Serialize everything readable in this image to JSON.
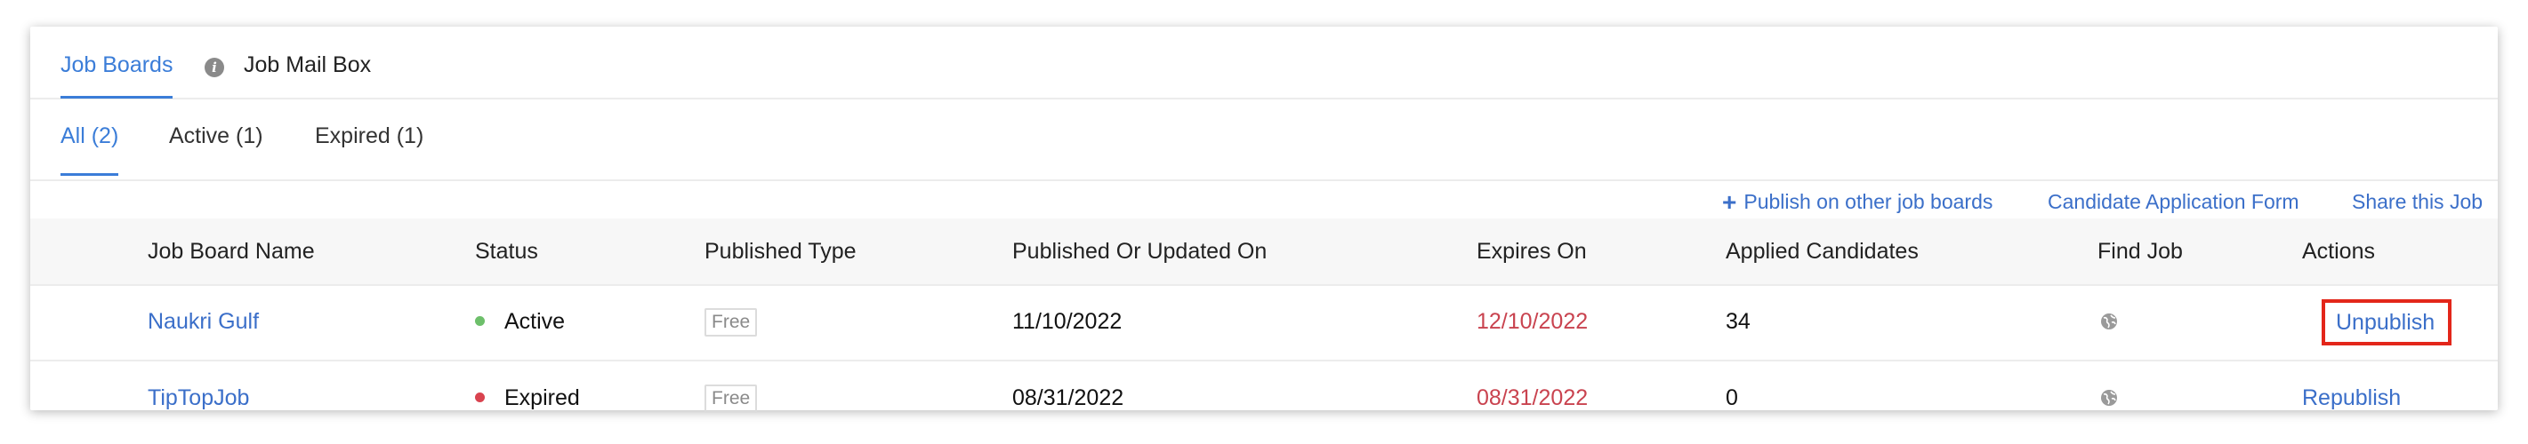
{
  "top_tabs": [
    {
      "label": "Job Boards",
      "active": true
    },
    {
      "label": "Job Mail Box",
      "active": false
    }
  ],
  "sub_tabs": [
    {
      "label": "All (2)",
      "active": true
    },
    {
      "label": "Active (1)",
      "active": false
    },
    {
      "label": "Expired (1)",
      "active": false
    }
  ],
  "links": {
    "publish_other": "Publish on other job boards",
    "candidate_form": "Candidate Application Form",
    "share_job": "Share this Job"
  },
  "table": {
    "headers": [
      "Job Board Name",
      "Status",
      "Published Type",
      "Published Or Updated On",
      "Expires On",
      "Applied Candidates",
      "Find Job",
      "Actions"
    ],
    "rows": [
      {
        "name": "Naukri Gulf",
        "status": "Active",
        "status_color": "#6dbf6a",
        "type": "Free",
        "published": "11/10/2022",
        "expires": "12/10/2022",
        "applied": "34",
        "action": "Unpublish"
      },
      {
        "name": "TipTopJob",
        "status": "Expired",
        "status_color": "#d9434f",
        "type": "Free",
        "published": "08/31/2022",
        "expires": "08/31/2022",
        "applied": "0",
        "action": "Republish"
      }
    ]
  },
  "colors": {
    "accent": "#3b7dd8",
    "expired_date": "#c9434f",
    "highlight": "#e3261a"
  }
}
